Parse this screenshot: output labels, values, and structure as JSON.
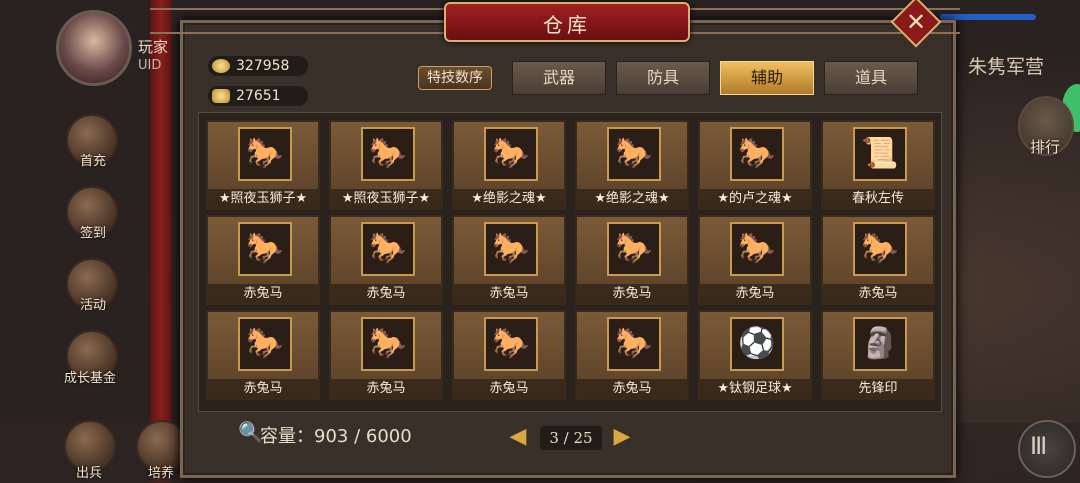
{
  "player": {
    "name_prefix": "玩家",
    "uid_label": "UID"
  },
  "side_menu": [
    "首充",
    "签到",
    "活动",
    "成长基金",
    "出兵",
    "培养"
  ],
  "right_panel": {
    "camp_title": "朱隽军营",
    "rank_label": "排行",
    "menu_glyph": "III"
  },
  "warehouse": {
    "title": "仓库",
    "close_glyph": "✕",
    "copper": "327958",
    "gold": "27651",
    "sort_button": "特技数序",
    "tabs": [
      {
        "label": "武器",
        "active": false
      },
      {
        "label": "防具",
        "active": false
      },
      {
        "label": "辅助",
        "active": true
      },
      {
        "label": "道具",
        "active": false
      }
    ],
    "items": [
      {
        "name": "★照夜玉狮子★",
        "icon": "white-horse-icon"
      },
      {
        "name": "★照夜玉狮子★",
        "icon": "white-horse-icon"
      },
      {
        "name": "★绝影之魂★",
        "icon": "dark-horse-icon"
      },
      {
        "name": "★绝影之魂★",
        "icon": "dark-horse-icon"
      },
      {
        "name": "★的卢之魂★",
        "icon": "red-horse-spirit-icon"
      },
      {
        "name": "春秋左传",
        "icon": "book-scroll-icon"
      },
      {
        "name": "赤兔马",
        "icon": "red-horse-icon"
      },
      {
        "name": "赤兔马",
        "icon": "red-horse-icon"
      },
      {
        "name": "赤兔马",
        "icon": "red-horse-icon"
      },
      {
        "name": "赤兔马",
        "icon": "red-horse-icon"
      },
      {
        "name": "赤兔马",
        "icon": "red-horse-icon"
      },
      {
        "name": "赤兔马",
        "icon": "red-horse-icon"
      },
      {
        "name": "赤兔马",
        "icon": "red-horse-icon"
      },
      {
        "name": "赤兔马",
        "icon": "red-horse-icon"
      },
      {
        "name": "赤兔马",
        "icon": "red-horse-icon"
      },
      {
        "name": "赤兔马",
        "icon": "red-horse-icon"
      },
      {
        "name": "★钛钢足球★",
        "icon": "soccer-ball-icon"
      },
      {
        "name": "先锋印",
        "icon": "seal-icon"
      }
    ],
    "capacity_text": "容量：903 / 6000",
    "page_text": "3 / 25"
  }
}
